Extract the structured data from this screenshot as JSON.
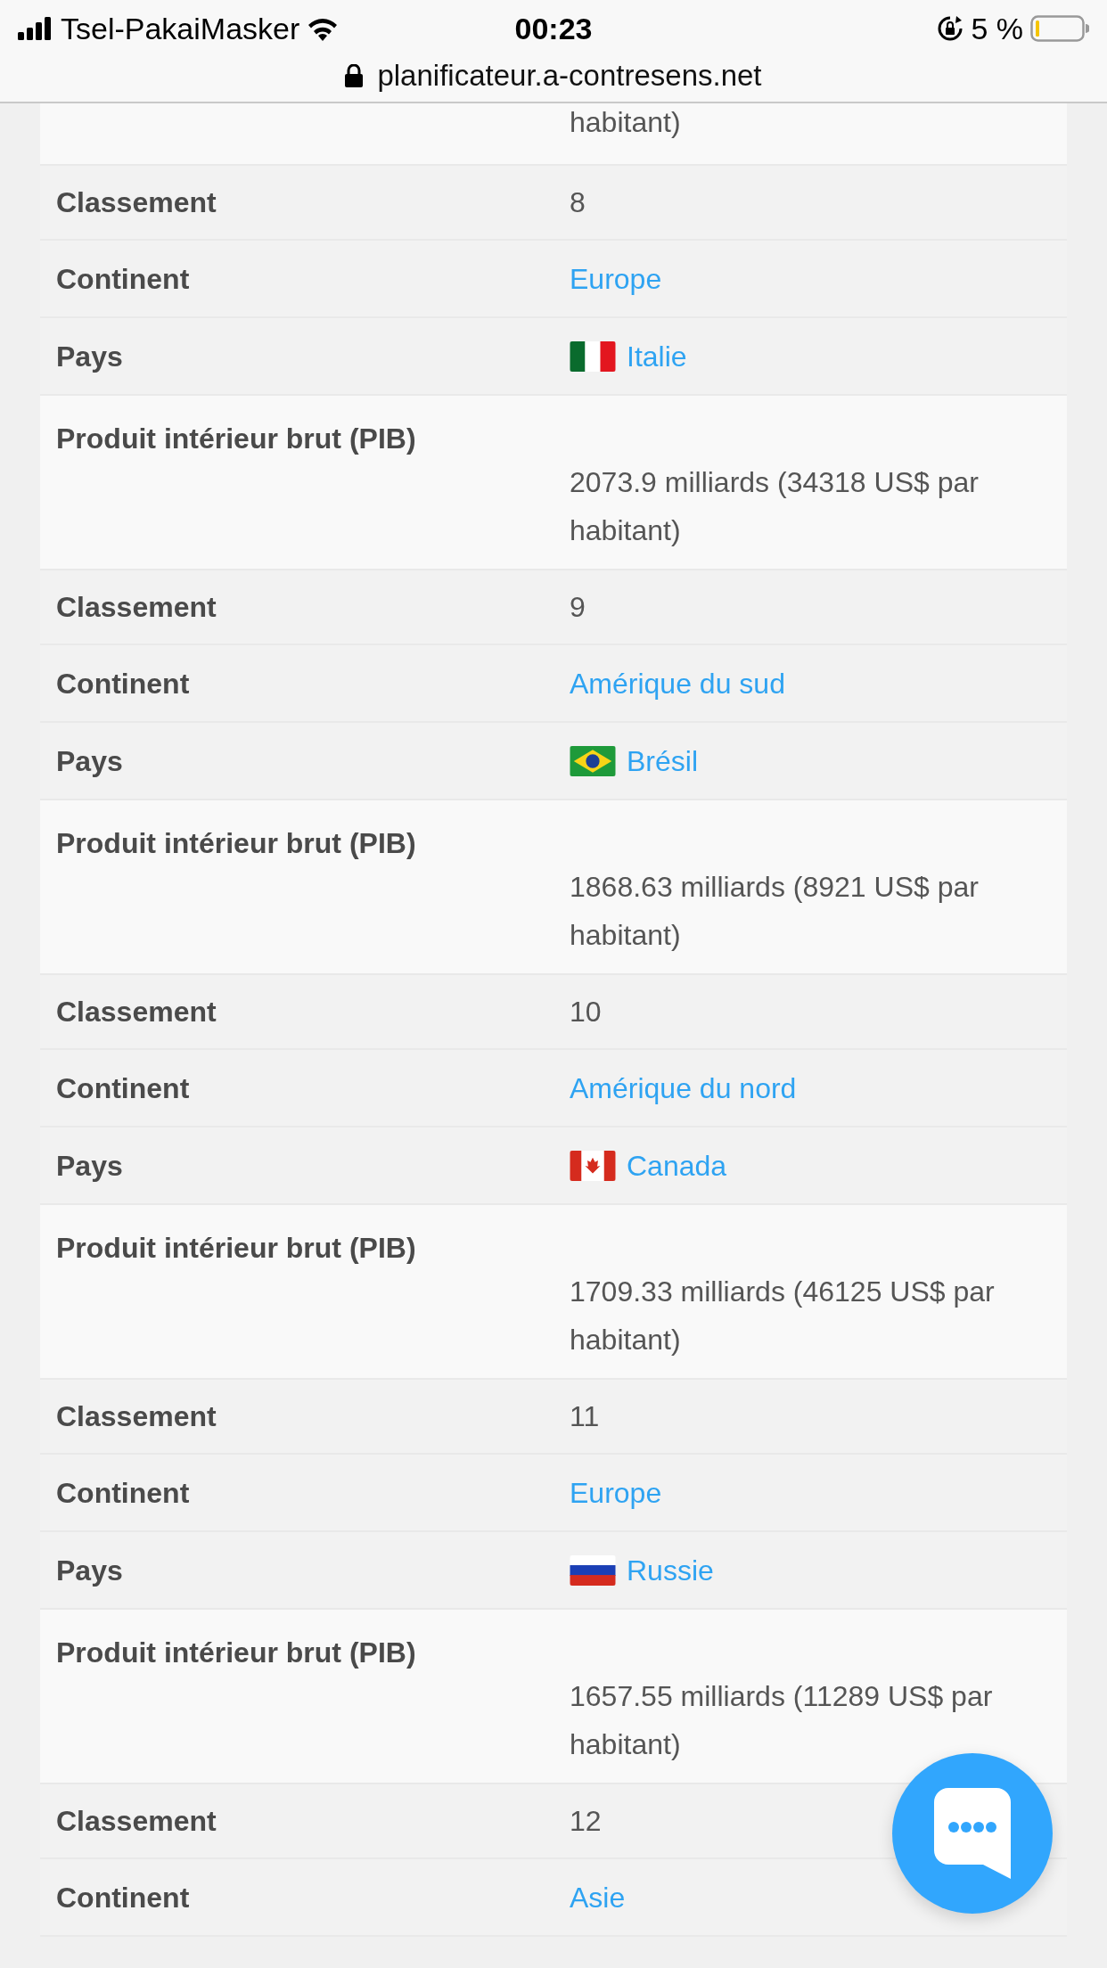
{
  "status_bar": {
    "carrier": "Tsel-PakaiMasker",
    "time": "00:23",
    "battery": "5 %"
  },
  "address_bar": {
    "url": "planificateur.a-contresens.net"
  },
  "rows": [
    {
      "kind": "continuation",
      "value": "habitant)"
    },
    {
      "kind": "text",
      "label": "Classement",
      "value": "8"
    },
    {
      "kind": "link",
      "label": "Continent",
      "value": "Europe"
    },
    {
      "kind": "country",
      "label": "Pays",
      "value": "Italie",
      "flag": {
        "kind": "italy"
      }
    },
    {
      "kind": "gdp",
      "label": "Produit intérieur brut (PIB)",
      "value": "2073.9 milliards (34318 US$ par habitant)"
    },
    {
      "kind": "text",
      "label": "Classement",
      "value": "9"
    },
    {
      "kind": "link",
      "label": "Continent",
      "value": "Amérique du sud"
    },
    {
      "kind": "country",
      "label": "Pays",
      "value": "Brésil",
      "flag": {
        "kind": "brazil"
      }
    },
    {
      "kind": "gdp",
      "label": "Produit intérieur brut (PIB)",
      "value": "1868.63 milliards (8921 US$ par habitant)"
    },
    {
      "kind": "text",
      "label": "Classement",
      "value": "10"
    },
    {
      "kind": "link",
      "label": "Continent",
      "value": "Amérique du nord"
    },
    {
      "kind": "country",
      "label": "Pays",
      "value": "Canada",
      "flag": {
        "kind": "canada"
      }
    },
    {
      "kind": "gdp",
      "label": "Produit intérieur brut (PIB)",
      "value": "1709.33 milliards (46125 US$ par habitant)"
    },
    {
      "kind": "text",
      "label": "Classement",
      "value": "11"
    },
    {
      "kind": "link",
      "label": "Continent",
      "value": "Europe"
    },
    {
      "kind": "country",
      "label": "Pays",
      "value": "Russie",
      "flag": {
        "kind": "russia"
      }
    },
    {
      "kind": "gdp",
      "label": "Produit intérieur brut (PIB)",
      "value": "1657.55 milliards (11289 US$ par habitant)"
    },
    {
      "kind": "text",
      "label": "Classement",
      "value": "12"
    },
    {
      "kind": "link",
      "label": "Continent",
      "value": "Asie"
    }
  ]
}
